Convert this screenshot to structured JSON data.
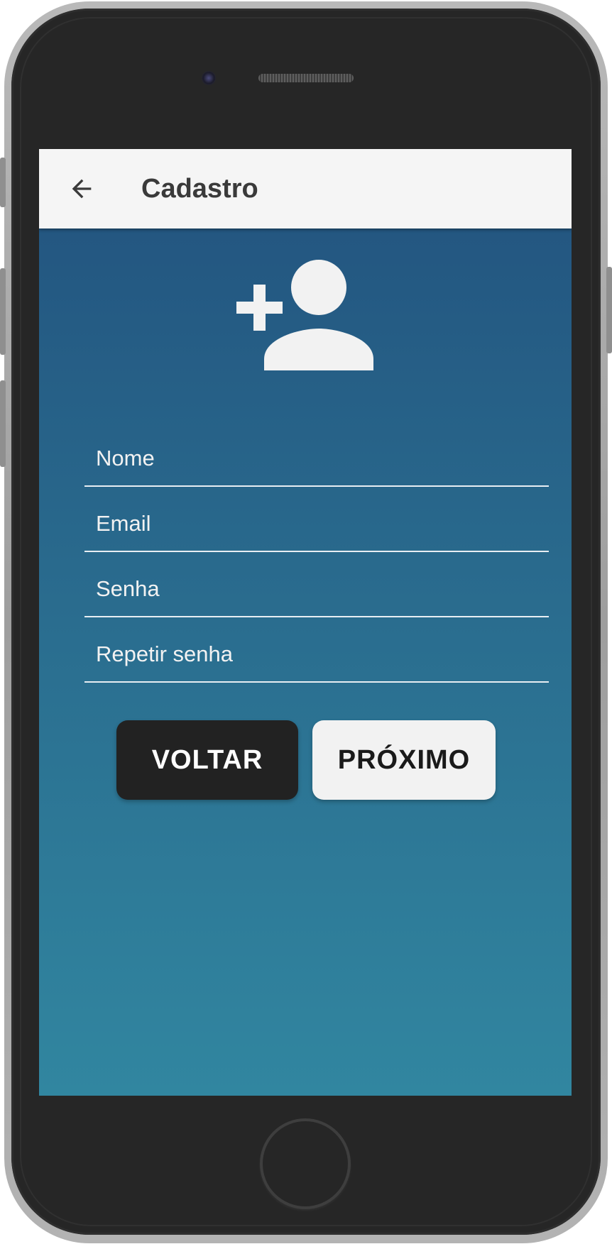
{
  "appbar": {
    "title": "Cadastro",
    "back_icon": "arrow-left-icon"
  },
  "header_icon": "person-add-icon",
  "form": {
    "fields": [
      {
        "placeholder": "Nome",
        "value": ""
      },
      {
        "placeholder": "Email",
        "value": ""
      },
      {
        "placeholder": "Senha",
        "value": ""
      },
      {
        "placeholder": "Repetir senha",
        "value": ""
      }
    ]
  },
  "buttons": {
    "back_label": "VOLTAR",
    "next_label": "PRÓXIMO"
  },
  "colors": {
    "background_top": "#22527e",
    "background_bottom": "#3186a0",
    "appbar": "#f5f5f5",
    "back_button": "#222222",
    "next_button": "#f2f2f2"
  }
}
